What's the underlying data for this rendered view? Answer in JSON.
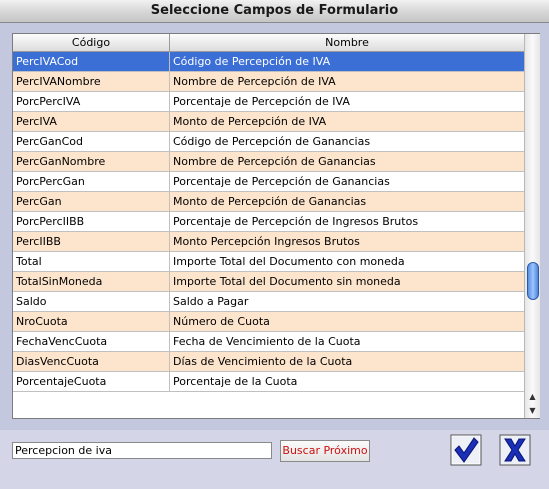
{
  "window": {
    "title": "Seleccione Campos de Formulario"
  },
  "table": {
    "columns": [
      "Código",
      "Nombre"
    ],
    "rows": [
      [
        "PercIVACod",
        "Código de Percepción de IVA"
      ],
      [
        "PercIVANombre",
        "Nombre de Percepción de IVA"
      ],
      [
        "PorcPercIVA",
        "Porcentaje de Percepción de IVA"
      ],
      [
        "PercIVA",
        "Monto de Percepción de IVA"
      ],
      [
        "PercGanCod",
        "Código de Percepción de Ganancias"
      ],
      [
        "PercGanNombre",
        "Nombre de Percepción de Ganancias"
      ],
      [
        "PorcPercGan",
        "Porcentaje de Percepción de Ganancias"
      ],
      [
        "PercGan",
        "Monto de Percepción de Ganancias"
      ],
      [
        "PorcPercIIBB",
        "Porcentaje de Percepción de Ingresos Brutos"
      ],
      [
        "PercIIBB",
        "Monto Percepción Ingresos Brutos"
      ],
      [
        "Total",
        "Importe Total del Documento con moneda"
      ],
      [
        "TotalSinMoneda",
        "Importe Total del Documento sin moneda"
      ],
      [
        "Saldo",
        "Saldo a Pagar"
      ],
      [
        "NroCuota",
        "Número de Cuota"
      ],
      [
        "FechaVencCuota",
        "Fecha de Vencimiento de la Cuota"
      ],
      [
        "DiasVencCuota",
        "Días de Vencimiento de la Cuota"
      ],
      [
        "PorcentajeCuota",
        "Porcentaje de la Cuota"
      ]
    ],
    "selected_row": 0
  },
  "search": {
    "value": "Percepcion de iva"
  },
  "buttons": {
    "next_label": "Buscar Próximo",
    "ok_icon": "checkmark-icon",
    "cancel_icon": "x-icon"
  },
  "colors": {
    "selection": "#3b6fd6",
    "alt_row": "#fde4cc",
    "accent_blue": "#1a2fb8"
  }
}
